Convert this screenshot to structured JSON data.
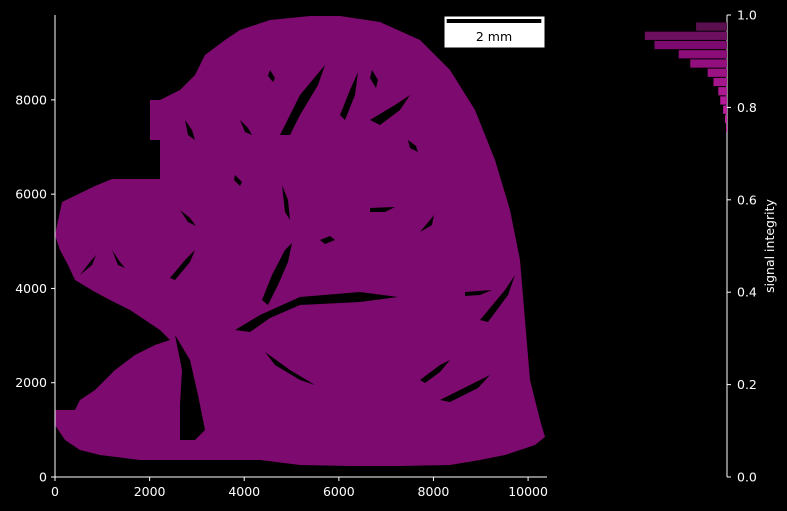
{
  "chart_data": [
    {
      "type": "image",
      "description_of_axes": "tissue map in micrometre coordinates",
      "xlim": [
        0,
        10400
      ],
      "ylim": [
        0,
        9800
      ],
      "x_ticks": [
        0,
        2000,
        4000,
        6000,
        8000,
        10000
      ],
      "y_ticks": [
        0,
        2000,
        4000,
        6000,
        8000
      ],
      "x_tick_labels": [
        "0",
        "2000",
        "4000",
        "6000",
        "8000",
        "10000"
      ],
      "y_tick_labels": [
        "0",
        "2000",
        "4000",
        "6000",
        "8000"
      ],
      "scalebar": {
        "label": "2 mm",
        "length": 2000
      },
      "fill_color": "#7d0a6e",
      "background": "#000000"
    },
    {
      "type": "bar",
      "orientation": "horizontal",
      "ylabel": "signal integrity",
      "ylim": [
        0,
        1.0
      ],
      "y_ticks": [
        0.0,
        0.2,
        0.4,
        0.6,
        0.8,
        1.0
      ],
      "y_tick_labels": [
        "0.0",
        "0.2",
        "0.4",
        "0.6",
        "0.8",
        "1.0"
      ],
      "bin_centers": [
        0.975,
        0.955,
        0.935,
        0.915,
        0.895,
        0.875,
        0.855,
        0.835,
        0.815,
        0.795,
        0.775,
        0.755
      ],
      "values": [
        32,
        85,
        75,
        50,
        38,
        20,
        14,
        9,
        7,
        4,
        2,
        1
      ],
      "xlim": [
        0,
        90
      ],
      "bar_colors": [
        "#5a0f4e",
        "#6d0f5f",
        "#7d0a6e",
        "#8a0d78",
        "#930f7e",
        "#9c1285",
        "#a5158c",
        "#ae1892",
        "#b51b98",
        "#bd1f9e",
        "#c422a4",
        "#cc26aa"
      ]
    }
  ]
}
